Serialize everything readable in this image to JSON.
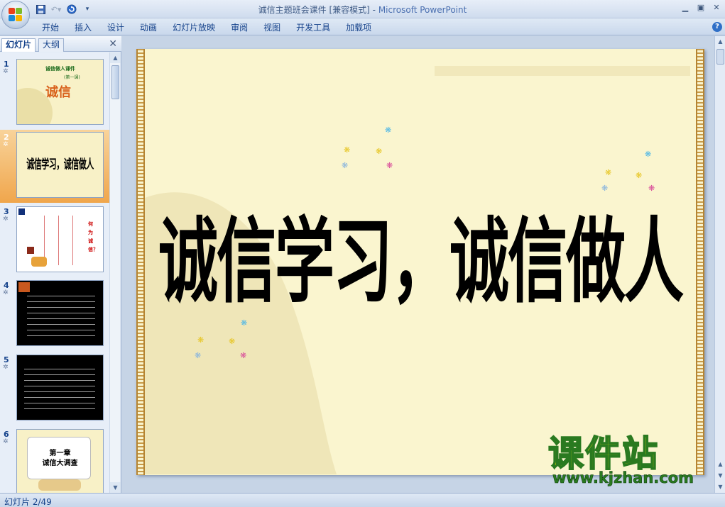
{
  "window": {
    "title_doc": "诚信主题班会课件 [兼容模式] - ",
    "title_app": "Microsoft PowerPoint"
  },
  "ribbon": {
    "tabs": [
      "开始",
      "插入",
      "设计",
      "动画",
      "幻灯片放映",
      "审阅",
      "视图",
      "开发工具",
      "加载项"
    ]
  },
  "pane": {
    "tabs": [
      "幻灯片",
      "大纲"
    ],
    "thumbnails": [
      {
        "number": "1",
        "title": "诚信",
        "subtitle": "诚信做人课件",
        "part": "(第一课)"
      },
      {
        "number": "2",
        "title": "诚信学习，诚信做人"
      },
      {
        "number": "3",
        "side_text": "何为诚信？"
      },
      {
        "number": "4"
      },
      {
        "number": "5"
      },
      {
        "number": "6",
        "title": "第一章",
        "subtitle": "诚信大调查"
      }
    ]
  },
  "slide": {
    "title": "诚信学习，诚信做人"
  },
  "watermark": {
    "name": "课件站",
    "url": "www.kjzhan.com"
  },
  "status": {
    "slide_indicator": "幻灯片 2/49"
  },
  "colors": {
    "slide_background": "#faf5cf",
    "selected_thumbnail": "#f0a64c",
    "watermark_yellow": "#ffee00",
    "watermark_green": "#2a7a20"
  }
}
